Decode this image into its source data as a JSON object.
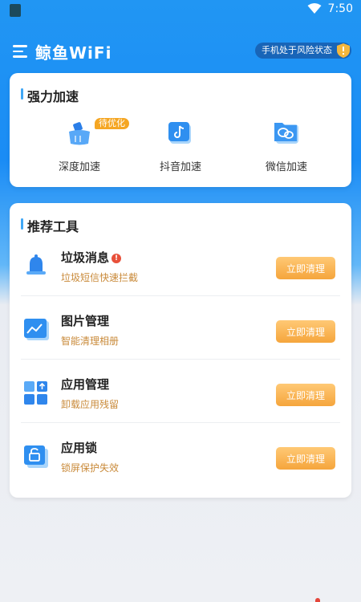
{
  "status_bar": {
    "time": "7:50"
  },
  "app_bar": {
    "title": "鲸鱼WiFi",
    "risk_status": "手机处于风险状态"
  },
  "boost": {
    "title": "强力加速",
    "items": [
      {
        "label": "深度加速",
        "badge": "待优化",
        "icon": "brush-icon"
      },
      {
        "label": "抖音加速",
        "icon": "music-note-icon"
      },
      {
        "label": "微信加速",
        "icon": "wechat-icon"
      }
    ]
  },
  "tools": {
    "title": "推荐工具",
    "items": [
      {
        "name": "垃圾消息",
        "desc": "垃圾短信快速拦截",
        "action": "立即清理",
        "icon": "bell-icon",
        "warning": "!"
      },
      {
        "name": "图片管理",
        "desc": "智能清理相册",
        "action": "立即清理",
        "icon": "picture-icon"
      },
      {
        "name": "应用管理",
        "desc": "卸载应用残留",
        "action": "立即清理",
        "icon": "app-grid-icon"
      },
      {
        "name": "应用锁",
        "desc": "锁屏保护失效",
        "action": "立即清理",
        "icon": "lock-icon"
      }
    ]
  },
  "colors": {
    "primary_blue": "#2196f3",
    "accent_orange": "#f5a53c",
    "desc_orange": "#c98a3a",
    "warning_red": "#e8503a"
  }
}
